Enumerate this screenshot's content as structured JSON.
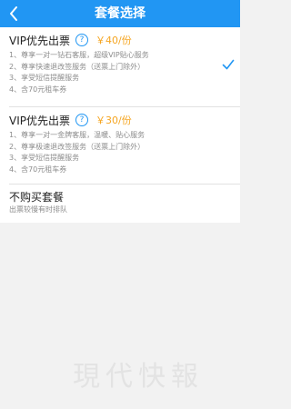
{
  "header": {
    "title": "套餐选择",
    "back_icon": "chevron-left-icon",
    "background": "#2196f3"
  },
  "packages": [
    {
      "title": "VIP优先出票",
      "help_glyph": "?",
      "price": "￥40/份",
      "selected": true,
      "features": [
        "1、尊享一对一钻石客服，超级VIP贴心服务",
        "2、尊享快速退改签服务（送票上门除外）",
        "3、享受短信提醒服务",
        "4、含70元租车券"
      ]
    },
    {
      "title": "VIP优先出票",
      "help_glyph": "?",
      "price": "￥30/份",
      "selected": false,
      "features": [
        "1、尊享一对一金牌客服，温暖、贴心服务",
        "2、尊享极速退改签服务（送票上门除外）",
        "3、享受短信提醒服务",
        "4、含70元租车券"
      ]
    },
    {
      "title": "不购买套餐",
      "description": "出票较慢有时排队",
      "selected": false
    }
  ],
  "watermark": {
    "text": "現代快報"
  },
  "colors": {
    "accent": "#2196f3",
    "price": "#f5a623",
    "muted_text": "#8c8c8c"
  }
}
